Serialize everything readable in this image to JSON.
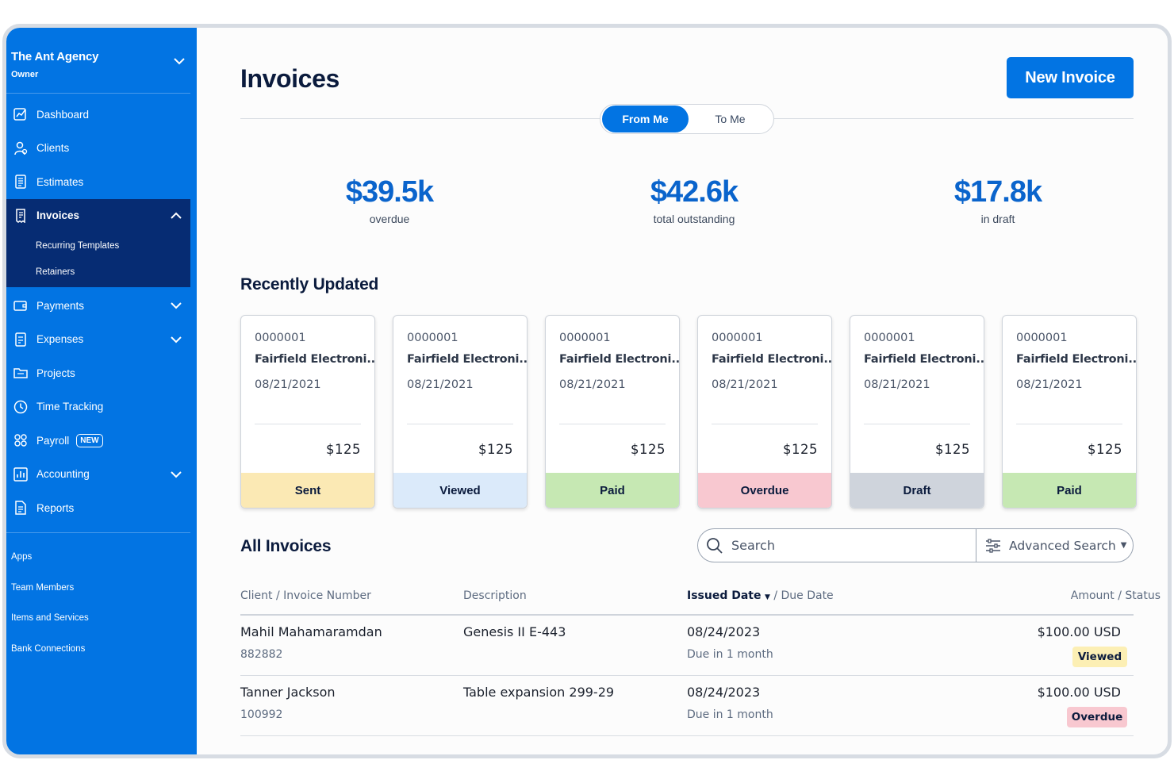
{
  "sidebar": {
    "agency_name": "The Ant Agency",
    "role": "Owner",
    "items": [
      {
        "label": "Dashboard",
        "icon": "dashboard-icon"
      },
      {
        "label": "Clients",
        "icon": "clients-icon"
      },
      {
        "label": "Estimates",
        "icon": "estimates-icon"
      },
      {
        "label": "Invoices",
        "icon": "invoices-icon",
        "expanded": true,
        "subitems": [
          {
            "label": "Recurring Templates"
          },
          {
            "label": "Retainers"
          }
        ]
      },
      {
        "label": "Payments",
        "icon": "payments-icon",
        "has_chevron": true
      },
      {
        "label": "Expenses",
        "icon": "expenses-icon",
        "has_chevron": true
      },
      {
        "label": "Projects",
        "icon": "projects-icon"
      },
      {
        "label": "Time Tracking",
        "icon": "clock-icon"
      },
      {
        "label": "Payroll",
        "icon": "payroll-icon",
        "badge": "NEW"
      },
      {
        "label": "Accounting",
        "icon": "accounting-icon",
        "has_chevron": true
      },
      {
        "label": "Reports",
        "icon": "reports-icon"
      }
    ],
    "links": [
      "Apps",
      "Team Members",
      "Items and Services",
      "Bank Connections"
    ]
  },
  "header": {
    "title": "Invoices",
    "new_button": "New Invoice",
    "toggle": {
      "selected": "From Me",
      "other": "To Me"
    }
  },
  "stats": [
    {
      "value": "$39.5k",
      "label": "overdue"
    },
    {
      "value": "$42.6k",
      "label": "total outstanding"
    },
    {
      "value": "$17.8k",
      "label": "in draft"
    }
  ],
  "recent": {
    "title": "Recently Updated",
    "cards": [
      {
        "number": "0000001",
        "client": "Fairfield Electroni...",
        "date": "08/21/2021",
        "amount": "$125",
        "status": "Sent",
        "status_color": "#fbe9b4"
      },
      {
        "number": "0000001",
        "client": "Fairfield Electroni...",
        "date": "08/21/2021",
        "amount": "$125",
        "status": "Viewed",
        "status_color": "#dbeafa"
      },
      {
        "number": "0000001",
        "client": "Fairfield Electroni...",
        "date": "08/21/2021",
        "amount": "$125",
        "status": "Paid",
        "status_color": "#c6e8b3"
      },
      {
        "number": "0000001",
        "client": "Fairfield Electroni...",
        "date": "08/21/2021",
        "amount": "$125",
        "status": "Overdue",
        "status_color": "#f8c8d0"
      },
      {
        "number": "0000001",
        "client": "Fairfield Electroni...",
        "date": "08/21/2021",
        "amount": "$125",
        "status": "Draft",
        "status_color": "#cfd4dc"
      },
      {
        "number": "0000001",
        "client": "Fairfield Electroni...",
        "date": "08/21/2021",
        "amount": "$125",
        "status": "Paid",
        "status_color": "#c6e8b3"
      }
    ]
  },
  "all": {
    "title": "All Invoices",
    "search_placeholder": "Search",
    "advanced_search": "Advanced Search",
    "columns": {
      "client": "Client / Invoice Number",
      "description": "Description",
      "issued": "Issued Date",
      "due": "/ Due Date",
      "amount": "Amount / Status"
    },
    "rows": [
      {
        "client": "Mahil Mahamaramdan",
        "number": "882882",
        "description": "Genesis II E-443",
        "issued": "08/24/2023",
        "due": "Due in 1 month",
        "amount": "$100.00 USD",
        "status": "Viewed",
        "status_color": "#fcefb4"
      },
      {
        "client": "Tanner Jackson",
        "number": "100992",
        "description": "Table expansion 299-29",
        "issued": "08/24/2023",
        "due": "Due in 1 month",
        "amount": "$100.00 USD",
        "status": "Overdue",
        "status_color": "#f8c8d0"
      }
    ]
  },
  "colors": {
    "brand_blue": "#0274e3",
    "sidebar_active": "#062c73",
    "stat_blue": "#0a64cc"
  }
}
